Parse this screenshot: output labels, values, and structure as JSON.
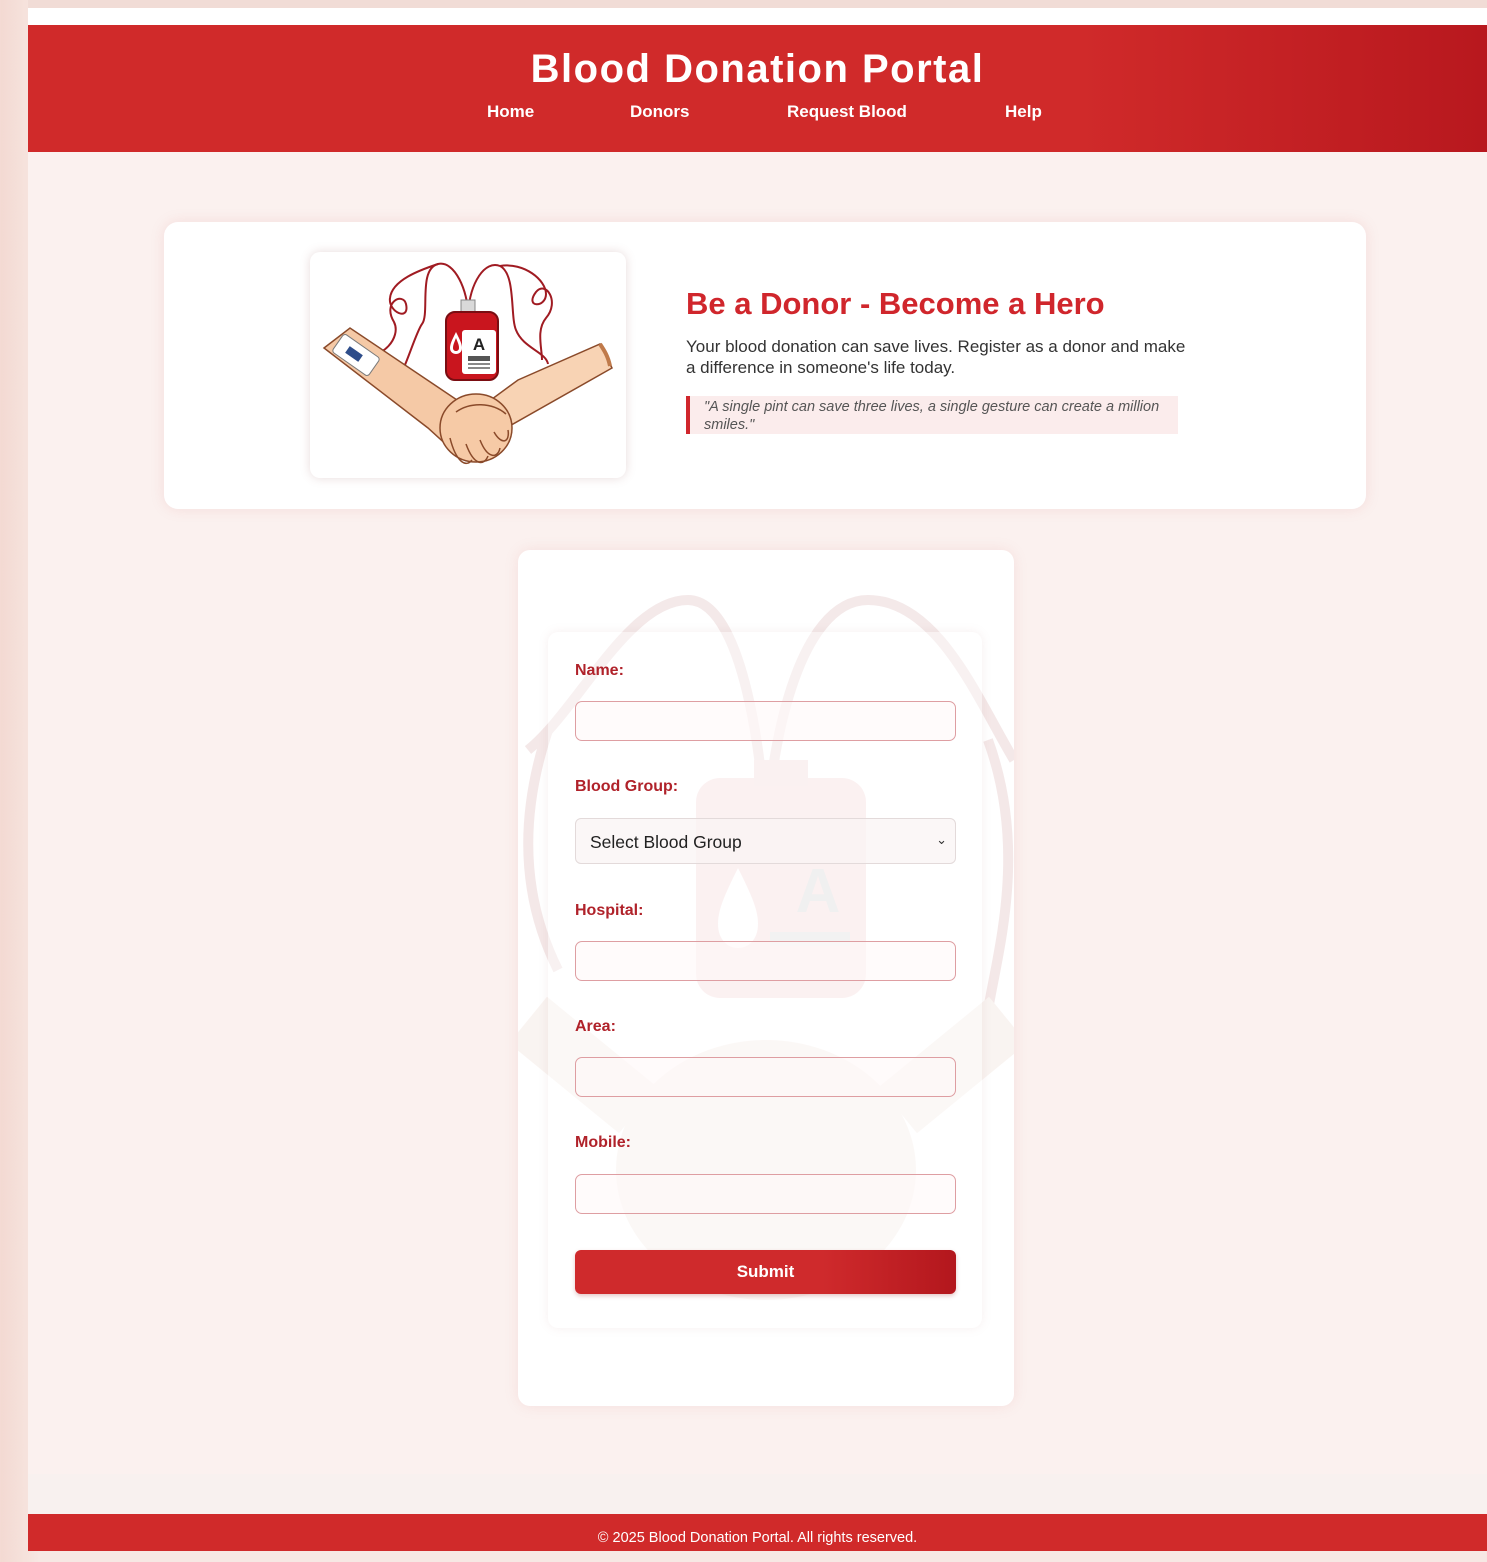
{
  "header": {
    "title": "Blood Donation Portal",
    "nav": [
      "Home",
      "Donors",
      "Request Blood",
      "Help"
    ]
  },
  "hero": {
    "heading": "Be a Donor - Become a Hero",
    "description": "Your blood donation can save lives. Register as a donor and make a difference in someone's life today.",
    "quote": "\"A single pint can save three lives, a single gesture can create a million smiles.\"",
    "illustration": {
      "bag_label": "A"
    }
  },
  "form": {
    "name_label": "Name:",
    "name_value": "",
    "blood_group_label": "Blood Group:",
    "blood_group_selected": "Select Blood Group",
    "hospital_label": "Hospital:",
    "hospital_value": "",
    "area_label": "Area:",
    "area_value": "",
    "mobile_label": "Mobile:",
    "mobile_value": "",
    "submit_label": "Submit"
  },
  "footer": {
    "text": "© 2025 Blood Donation Portal. All rights reserved."
  },
  "colors": {
    "primary": "#d02a2a",
    "primary_dark": "#b3171d",
    "background": "#fbf1ef"
  },
  "icons": [
    "blood-bag-handshake-illustration",
    "chevron-down-icon"
  ]
}
